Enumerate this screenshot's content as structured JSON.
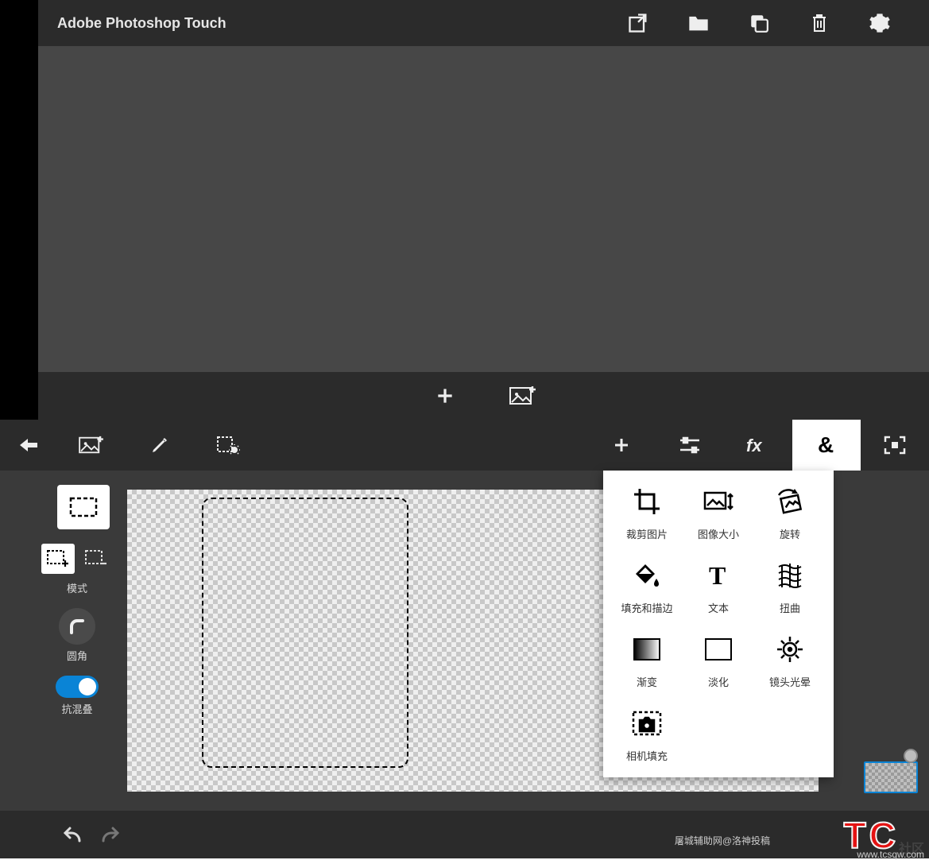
{
  "top": {
    "title": "Adobe Photoshop Touch",
    "toolbar": {
      "share": "share-icon",
      "folder": "folder-icon",
      "copy": "copy-icon",
      "trash": "trash-icon",
      "settings": "gear-icon"
    },
    "bottombar": {
      "add": "plus-icon",
      "add_image": "image-plus-icon"
    }
  },
  "editor": {
    "topbar": {
      "back": "back-arrow-icon",
      "add_image": "image-plus-icon",
      "brush": "pencil-icon",
      "selection_settings": "selection-gear-icon",
      "add": "plus-icon",
      "adjust": "sliders-icon",
      "fx": "fx-icon",
      "transform": "ampersand-icon",
      "fullscreen": "fullscreen-icon",
      "active": "transform"
    },
    "sidebar": {
      "selection_tool": "marquee-icon",
      "mode_add": "selection-add-icon",
      "mode_sub": "selection-subtract-icon",
      "mode_label": "模式",
      "corner_label": "圆角",
      "antialias_label": "抗混叠",
      "antialias_on": true
    },
    "bottombar": {
      "undo": "undo-icon",
      "redo": "redo-icon"
    },
    "popup_items": [
      {
        "id": "crop",
        "label": "裁剪图片"
      },
      {
        "id": "image-size",
        "label": "图像大小"
      },
      {
        "id": "rotate",
        "label": "旋转"
      },
      {
        "id": "fill-stroke",
        "label": "填充和描边"
      },
      {
        "id": "text",
        "label": "文本"
      },
      {
        "id": "warp",
        "label": "扭曲"
      },
      {
        "id": "gradient",
        "label": "渐变"
      },
      {
        "id": "fade",
        "label": "淡化"
      },
      {
        "id": "lens-flare",
        "label": "镜头光晕"
      },
      {
        "id": "camera-fill",
        "label": "相机填充"
      }
    ],
    "watermark": {
      "t1": "T",
      "t2": "C",
      "sub": "社区",
      "url": "www.tcsqw.com",
      "credit": "屠城辅助网@洛神投稿"
    }
  }
}
